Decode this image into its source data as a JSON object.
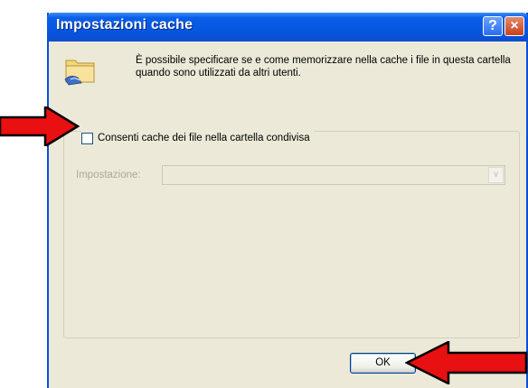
{
  "dialog": {
    "title": "Impostazioni cache",
    "help_button": "?",
    "close_button": "×",
    "description": "È possibile specificare se e come memorizzare nella cache i file in questa cartella quando sono utilizzati da altri utenti.",
    "checkbox": {
      "label": "Consenti cache dei file nella cartella condivisa",
      "checked": false
    },
    "setting": {
      "label": "Impostazione:",
      "selected_value": "",
      "disabled": true
    },
    "ok_button": "OK"
  },
  "annotations": {
    "arrow_color": "#e81010",
    "icons": [
      "folder-shared-icon",
      "red-arrow-right-icon",
      "red-arrow-left-icon"
    ]
  },
  "colors": {
    "titlebar": "#0656e0",
    "dialog_bg": "#ece9d8",
    "disabled_text": "#aca899"
  }
}
